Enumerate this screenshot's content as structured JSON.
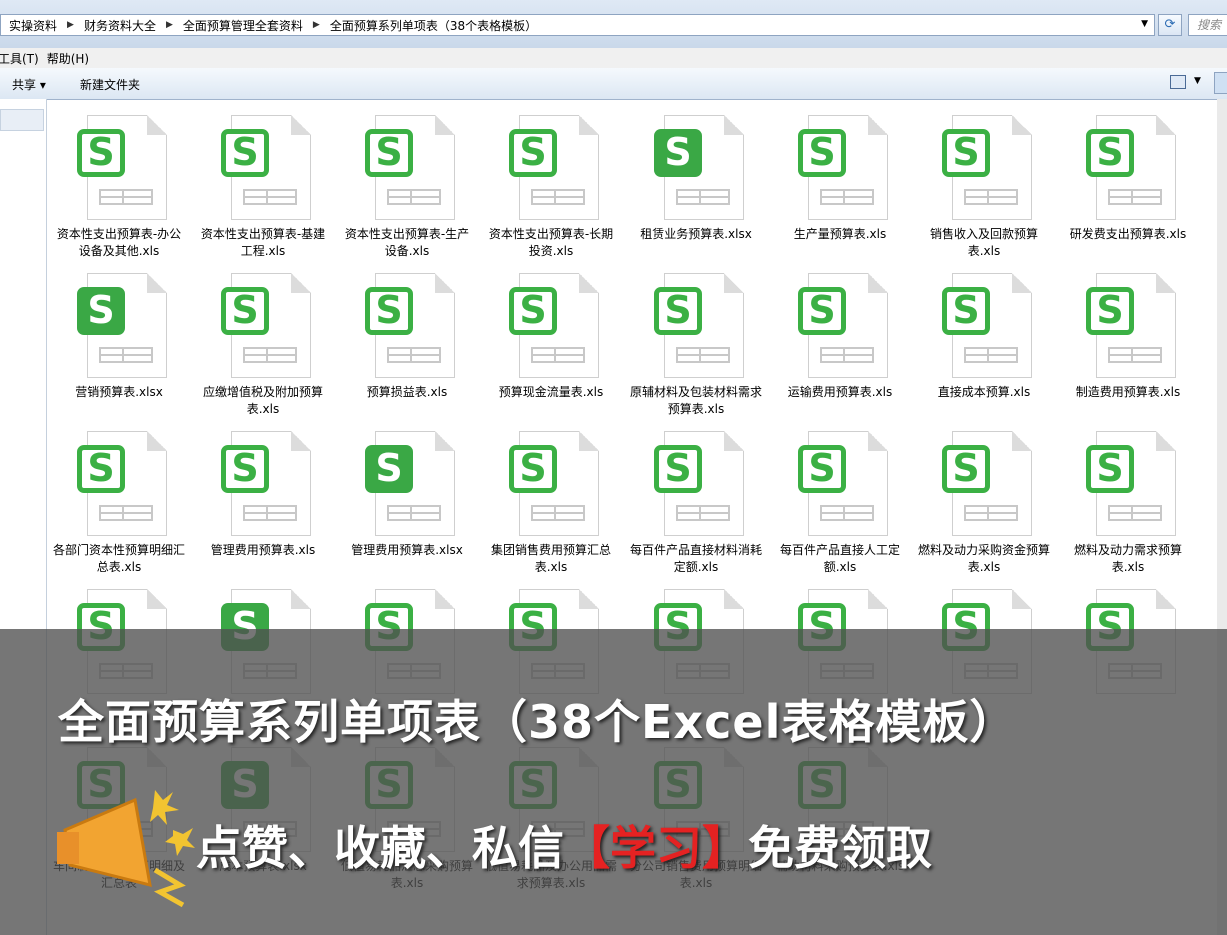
{
  "breadcrumb": [
    "实操资料",
    "财务资料大全",
    "全面预算管理全套资料",
    "全面预算系列单项表（38个表格模板）"
  ],
  "search_placeholder": "搜索",
  "menu": [
    "工具(T)",
    "帮助(H)"
  ],
  "toolbar": {
    "share": "共享 ▾",
    "new_folder": "新建文件夹"
  },
  "files": [
    {
      "name": "资本性支出预算表-办公设备及其他.xls",
      "style": "outline"
    },
    {
      "name": "资本性支出预算表-基建工程.xls",
      "style": "outline"
    },
    {
      "name": "资本性支出预算表-生产设备.xls",
      "style": "outline"
    },
    {
      "name": "资本性支出预算表-长期投资.xls",
      "style": "outline"
    },
    {
      "name": "租赁业务预算表.xlsx",
      "style": "solid"
    },
    {
      "name": "生产量预算表.xls",
      "style": "outline"
    },
    {
      "name": "销售收入及回款预算表.xls",
      "style": "outline"
    },
    {
      "name": "研发费支出预算表.xls",
      "style": "outline"
    },
    {
      "name": "营销预算表.xlsx",
      "style": "solid"
    },
    {
      "name": "应缴增值税及附加预算表.xls",
      "style": "outline"
    },
    {
      "name": "预算损益表.xls",
      "style": "outline"
    },
    {
      "name": "预算现金流量表.xls",
      "style": "outline"
    },
    {
      "name": "原辅材料及包装材料需求预算表.xls",
      "style": "outline"
    },
    {
      "name": "运输费用预算表.xls",
      "style": "outline"
    },
    {
      "name": "直接成本预算.xls",
      "style": "outline"
    },
    {
      "name": "制造费用预算表.xls",
      "style": "outline"
    },
    {
      "name": "各部门资本性预算明细汇总表.xls",
      "style": "outline"
    },
    {
      "name": "管理费用预算表.xls",
      "style": "outline"
    },
    {
      "name": "管理费用预算表.xlsx",
      "style": "solid"
    },
    {
      "name": "集团销售费用预算汇总表.xls",
      "style": "outline"
    },
    {
      "name": "每百件产品直接材料消耗定额.xls",
      "style": "outline"
    },
    {
      "name": "每百件产品直接人工定额.xls",
      "style": "outline"
    },
    {
      "name": "燃料及动力采购资金预算表.xls",
      "style": "outline"
    },
    {
      "name": "燃料及动力需求预算表.xls",
      "style": "outline"
    },
    {
      "name": "",
      "style": "outline"
    },
    {
      "name": "",
      "style": "solid"
    },
    {
      "name": "",
      "style": "outline"
    },
    {
      "name": "",
      "style": "outline"
    },
    {
      "name": "",
      "style": "outline"
    },
    {
      "name": "",
      "style": "outline"
    },
    {
      "name": "",
      "style": "outline"
    },
    {
      "name": "",
      "style": "outline"
    },
    {
      "name": "车间制造费用预算明细及汇总表",
      "style": "outline"
    },
    {
      "name": "成本预算表.xlsx",
      "style": "solid"
    },
    {
      "name": "低值易耗品汇总采购预算表.xls",
      "style": "outline"
    },
    {
      "name": "低值易耗品及办公用品需求预算表.xls",
      "style": "outline"
    },
    {
      "name": "分公司销售费用预算明细表.xls",
      "style": "outline"
    },
    {
      "name": "辅助材料采购预算表.xls",
      "style": "outline"
    }
  ],
  "banner": {
    "title": "全面预算系列单项表（38个Excel表格模板）",
    "sub_before": "点赞、收藏、私信",
    "sub_highlight": "【学习】",
    "sub_after": "免费领取"
  }
}
